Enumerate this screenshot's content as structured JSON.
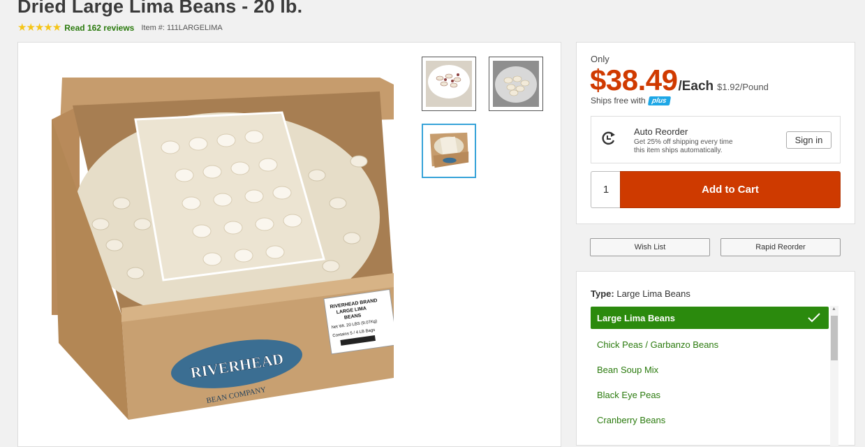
{
  "product": {
    "title": "Dried Large Lima Beans - 20 lb.",
    "rating_stars": 5,
    "reviews_link": "Read 162 reviews",
    "item_number": "Item #: 111LARGELIMA"
  },
  "gallery": {
    "main_image": "riverhead-beans-box-image",
    "box_label_brand": "RIVERHEAD",
    "box_label_sub": "BEAN COMPANY",
    "sticker_lines": [
      "RIVERHEAD BRAND",
      "LARGE LIMA",
      "BEANS",
      "Net Wt. 20 LBS (9.07Kg)",
      "Contains 5 / 4 LB Bags"
    ],
    "thumbnails": [
      "bean-bowl-thumb",
      "lima-bowl-thumb",
      "box-thumb"
    ],
    "selected_thumbnail": 2
  },
  "pricing": {
    "only_label": "Only",
    "price": "$38.49",
    "per": "/Each",
    "unit_price": "$1.92/Pound",
    "ships_free": "Ships free with",
    "plus_badge": "plus",
    "accent_color": "#d03a00"
  },
  "auto_reorder": {
    "title": "Auto Reorder",
    "desc_line1": "Get 25% off shipping every time",
    "desc_line2": "this item ships automatically.",
    "sign_in": "Sign in"
  },
  "cart": {
    "quantity": "1",
    "add_label": "Add to Cart",
    "button_color": "#ce3a00"
  },
  "actions": {
    "wish_list": "Wish List",
    "rapid_reorder": "Rapid Reorder"
  },
  "type_selector": {
    "label": "Type:",
    "value": "Large Lima Beans",
    "options": [
      "Large Lima Beans",
      "Chick Peas / Garbanzo Beans",
      "Bean Soup Mix",
      "Black Eye Peas",
      "Cranberry Beans"
    ],
    "selected_index": 0,
    "selected_color": "#2b8a0d"
  }
}
